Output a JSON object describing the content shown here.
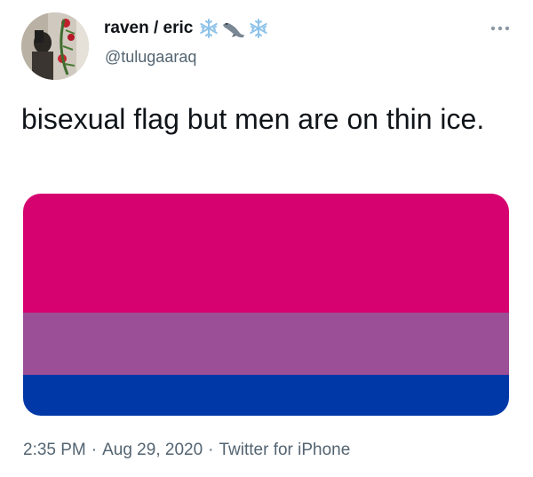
{
  "author": {
    "display_name": "raven / eric",
    "handle": "@tulugaaraq",
    "name_emoji": [
      "snowflake-icon",
      "seal-icon",
      "snowflake-icon"
    ]
  },
  "tweet": {
    "text": "bisexual flag but men are on thin ice."
  },
  "media": {
    "stripe_colors": [
      "#d60270",
      "#9b4f96",
      "#0038a8"
    ]
  },
  "meta": {
    "time": "2:35 PM",
    "separator": "·",
    "date": "Aug 29, 2020",
    "source": "Twitter for iPhone"
  },
  "colors": {
    "text_primary": "#0f1419",
    "text_secondary": "#536471",
    "emoji_blue": "#8fc3ea",
    "emoji_gray": "#7a8794"
  }
}
